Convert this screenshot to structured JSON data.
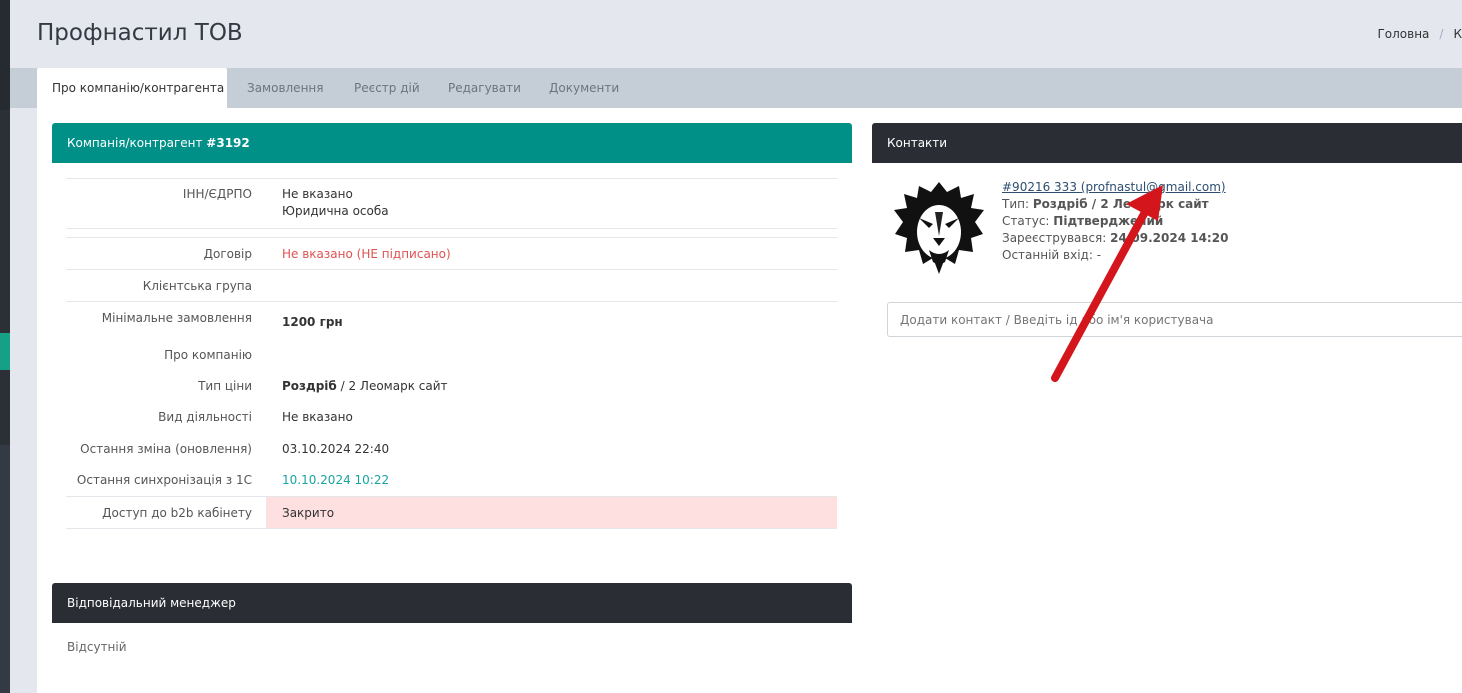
{
  "header": {
    "title": "Профнастил ТОВ",
    "breadcrumb": [
      "Головна",
      "К"
    ]
  },
  "tabs": [
    {
      "label": "Про компанію/контрагента",
      "active": true
    },
    {
      "label": "Замовлення",
      "active": false
    },
    {
      "label": "Реєстр дій",
      "active": false
    },
    {
      "label": "Редагувати",
      "active": false
    },
    {
      "label": "Документи",
      "active": false
    }
  ],
  "company_panel": {
    "title_prefix": "Компанія/контрагент ",
    "title_id": "#3192"
  },
  "company_fields": {
    "inn": {
      "label": "ІНН/ЄДРПО",
      "value_line1": "Не вказано",
      "value_line2": "Юридична особа"
    },
    "contract": {
      "label": "Договір",
      "value": "Не вказано (НЕ підписано)"
    },
    "client_group": {
      "label": "Клієнтська група",
      "value": ""
    },
    "min_order": {
      "label": "Мінімальне замовлення",
      "value": "1200 грн"
    },
    "about": {
      "label": "Про компанію",
      "value": ""
    },
    "price_type": {
      "label": "Тип ціни",
      "value_bold": "Роздріб",
      "value_rest": " / 2 Леомарк сайт"
    },
    "activity": {
      "label": "Вид діяльності",
      "value": "Не вказано"
    },
    "last_change": {
      "label": "Остання зміна (оновлення)",
      "value": "03.10.2024 22:40"
    },
    "last_sync": {
      "label": "Остання синхронізація з 1С",
      "value": "10.10.2024 10:22"
    },
    "b2b_access": {
      "label": "Доступ до b2b кабінету",
      "value": "Закрито"
    }
  },
  "contacts_panel": {
    "title": "Контакти",
    "contact": {
      "link": "#90216 333 (profnastul@gmail.com)",
      "type_label": "Тип: ",
      "type_value": "Роздріб / 2 Леомарк сайт",
      "status_label": "Статус: ",
      "status_value": "Підтверджений",
      "registered_label": "Зареєструвався: ",
      "registered_value": "24.09.2024 14:20",
      "last_login_label": "Останній вхід: ",
      "last_login_value": "-"
    },
    "add_placeholder": "Додати контакт / Введіть ід або ім'я користувача"
  },
  "manager_panel": {
    "title": "Відповідальний менеджер",
    "value": "Відсутній"
  },
  "colors": {
    "teal_header": "#009088",
    "dark_header": "#2a2d33",
    "annotation_arrow": "#d4151c"
  }
}
